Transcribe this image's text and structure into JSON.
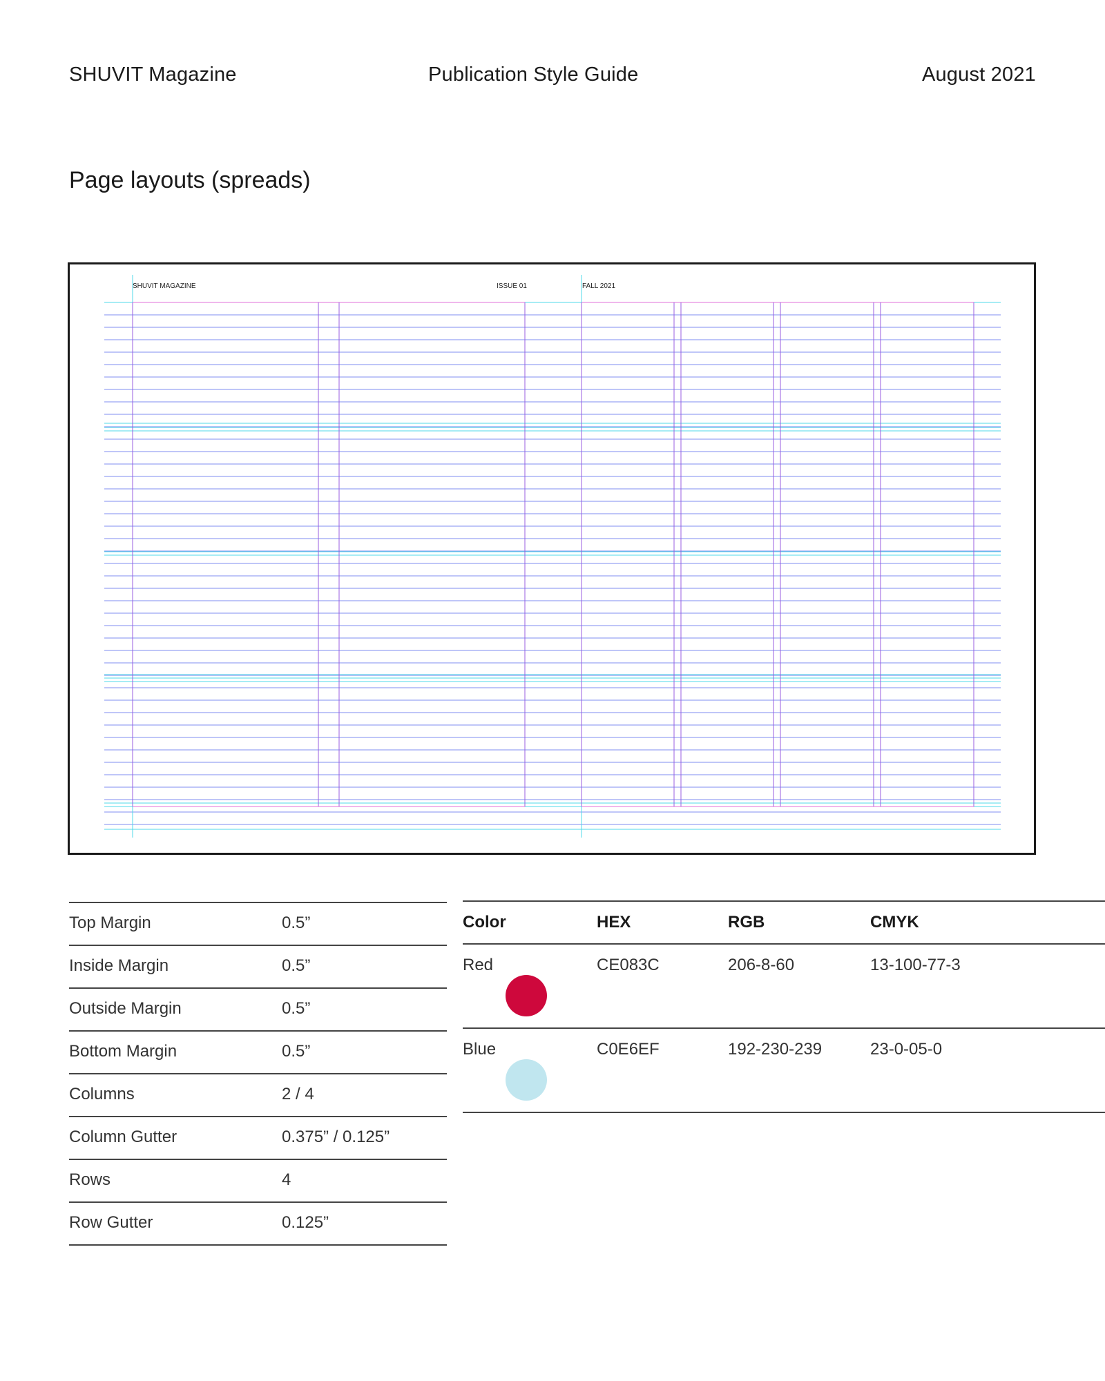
{
  "header": {
    "left": "SHUVIT Magazine",
    "center": "Publication Style Guide",
    "right": "August 2021"
  },
  "title": "Page layouts (spreads)",
  "spread": {
    "running_head_left": "SHUVIT MAGAZINE",
    "running_head_issue": "ISSUE 01",
    "running_head_right": "FALL 2021"
  },
  "specs": [
    {
      "label": "Top Margin",
      "value": "0.5”"
    },
    {
      "label": "Inside Margin",
      "value": "0.5”"
    },
    {
      "label": "Outside Margin",
      "value": "0.5”"
    },
    {
      "label": "Bottom Margin",
      "value": "0.5”"
    },
    {
      "label": "Columns",
      "value": "2 / 4"
    },
    {
      "label": "Column Gutter",
      "value": "0.375” / 0.125”"
    },
    {
      "label": "Rows",
      "value": "4"
    },
    {
      "label": "Row Gutter",
      "value": "0.125”"
    }
  ],
  "colors": {
    "headers": {
      "color": "Color",
      "hex": "HEX",
      "rgb": "RGB",
      "cmyk": "CMYK"
    },
    "rows": [
      {
        "name": "Red",
        "hex": "CE083C",
        "rgb": "206-8-60",
        "cmyk": "13-100-77-3",
        "swatch": "#CE083C"
      },
      {
        "name": "Blue",
        "hex": "C0E6EF",
        "rgb": "192-230-239",
        "cmyk": "23-0-05-0",
        "swatch": "#C0E6EF"
      }
    ]
  },
  "guide_colors": {
    "baseline": "#7f8ef0",
    "bleed": "#4fd8e8",
    "margin": "#e070d8",
    "column": "#9a5ce0"
  }
}
